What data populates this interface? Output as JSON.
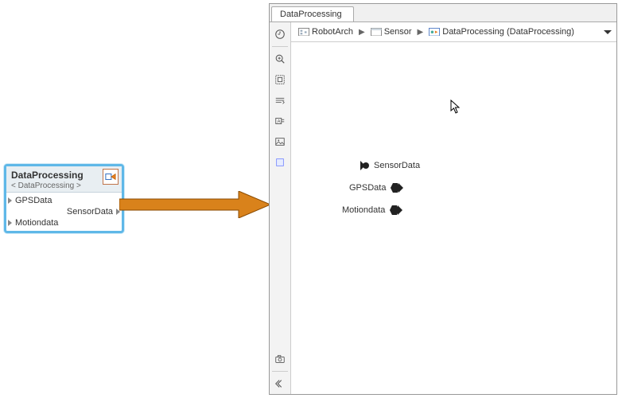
{
  "block": {
    "title": "DataProcessing",
    "subtitle": "< DataProcessing >",
    "ports_in": [
      "GPSData",
      "Motiondata"
    ],
    "ports_out": [
      "SensorData"
    ]
  },
  "panel": {
    "tab": "DataProcessing",
    "breadcrumb": {
      "root": "RobotArch",
      "mid": "Sensor",
      "leaf": "DataProcessing (DataProcessing)"
    },
    "canvas_ports": {
      "sensor": "SensorData",
      "gps": "GPSData",
      "motion": "Motiondata"
    }
  },
  "tools": {
    "nav": "navigate",
    "zoom": "zoom",
    "fit": "fit-to-view",
    "auto": "auto-arrange",
    "annot": "annotation",
    "img": "image",
    "box": "area",
    "cam": "camera",
    "collapse": "collapse"
  }
}
